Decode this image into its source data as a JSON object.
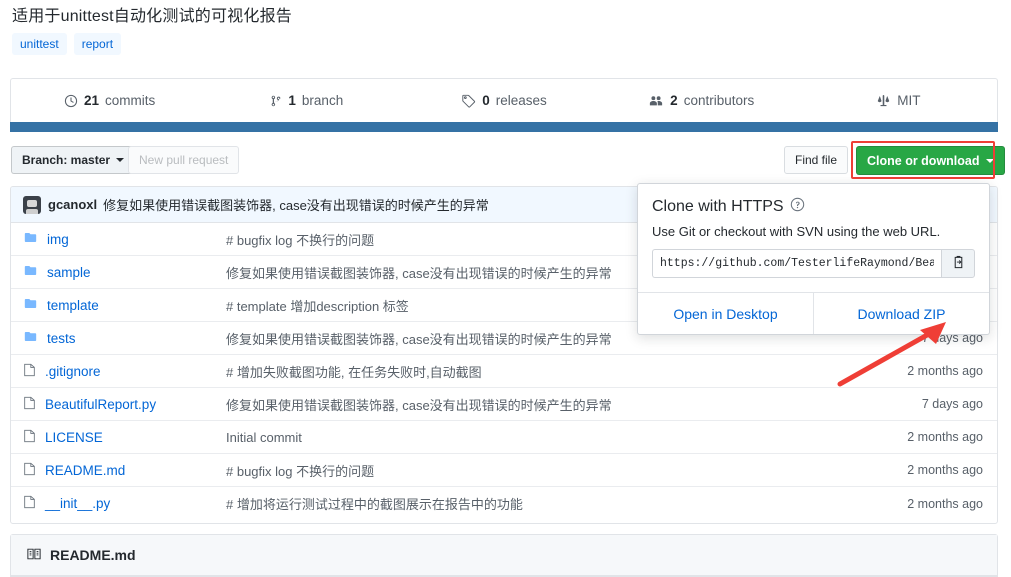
{
  "repo": {
    "description": "适用于unittest自动化测试的可视化报告",
    "topics": [
      "unittest",
      "report"
    ]
  },
  "stats": [
    {
      "icon": "history-icon",
      "count": "21",
      "label": "commits"
    },
    {
      "icon": "branch-icon",
      "count": "1",
      "label": "branch"
    },
    {
      "icon": "tag-icon",
      "count": "0",
      "label": "releases"
    },
    {
      "icon": "people-icon",
      "count": "2",
      "label": "contributors"
    },
    {
      "icon": "law-icon",
      "count": "",
      "label": "MIT"
    }
  ],
  "language_bar_color": "#3572A5",
  "toolbar": {
    "branch_label": "Branch: master",
    "new_pull_request": "New pull request",
    "find_file": "Find file",
    "clone_or_download": "Clone or download",
    "highlight_color": "#ef3e36",
    "clone_button_color": "#28a745"
  },
  "latest_commit": {
    "author": "gcanoxl",
    "message": "修复如果使用错误截图装饰器, case没有出现错误的时候产生的异常"
  },
  "files": [
    {
      "type": "folder",
      "name": "img",
      "message": "# bugfix log 不换行的问题",
      "time": ""
    },
    {
      "type": "folder",
      "name": "sample",
      "message": "修复如果使用错误截图装饰器, case没有出现错误的时候产生的异常",
      "time": ""
    },
    {
      "type": "folder",
      "name": "template",
      "message": "# template 增加description 标签",
      "time": ""
    },
    {
      "type": "folder",
      "name": "tests",
      "message": "修复如果使用错误截图装饰器, case没有出现错误的时候产生的异常",
      "time": "7 days ago"
    },
    {
      "type": "file",
      "name": ".gitignore",
      "message": "# 增加失败截图功能, 在任务失败时,自动截图",
      "time": "2 months ago"
    },
    {
      "type": "file",
      "name": "BeautifulReport.py",
      "message": "修复如果使用错误截图装饰器, case没有出现错误的时候产生的异常",
      "time": "7 days ago"
    },
    {
      "type": "file",
      "name": "LICENSE",
      "message": "Initial commit",
      "time": "2 months ago"
    },
    {
      "type": "file",
      "name": "README.md",
      "message": "# bugfix log 不换行的问题",
      "time": "2 months ago"
    },
    {
      "type": "file",
      "name": "__init__.py",
      "message": "# 增加将运行测试过程中的截图展示在报告中的功能",
      "time": "2 months ago"
    }
  ],
  "clone_popup": {
    "title": "Clone with HTTPS",
    "help_icon": "question-icon",
    "subtitle": "Use Git or checkout with SVN using the web URL.",
    "url_value": "https://github.com/TesterlifeRaymond/Beaut",
    "copy_icon": "clipboard-icon",
    "open_in_desktop": "Open in Desktop",
    "download_zip": "Download ZIP"
  },
  "readme": {
    "icon": "book-icon",
    "title": "README.md"
  },
  "annotations": {
    "arrow_color": "#ef3e36"
  }
}
